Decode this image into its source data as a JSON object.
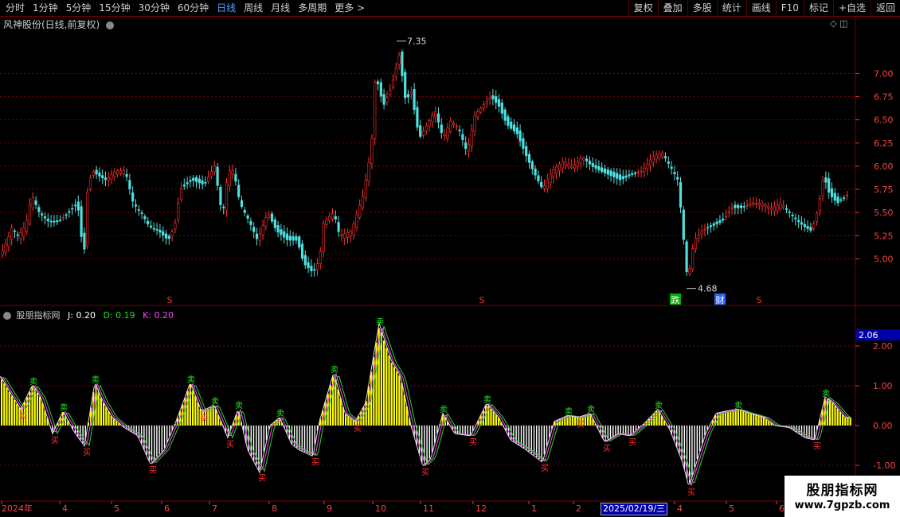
{
  "toolbar": {
    "periods": [
      "分时",
      "1分钟",
      "5分钟",
      "15分钟",
      "30分钟",
      "60分钟",
      "日线",
      "周线",
      "月线",
      "多周期",
      "更多 >"
    ],
    "active_period": "日线",
    "actions": [
      "复权",
      "叠加",
      "多股",
      "统计",
      "画线",
      "F10",
      "标记",
      "+自选",
      "返回"
    ]
  },
  "main_chart": {
    "title": "风神股份(日线,前复权)",
    "y_ticks": [
      "7.00",
      "6.75",
      "6.50",
      "6.25",
      "6.00",
      "5.75",
      "5.50",
      "5.25",
      "5.00"
    ],
    "max_label": "7.35",
    "min_label": "4.68",
    "markers": [
      "S",
      "S",
      "跌",
      "财",
      "S"
    ]
  },
  "indicator": {
    "name": "股朋指标网",
    "j_label": "J: 0.20",
    "d_label": "D: 0.19",
    "k_label": "K: 0.20",
    "y_ticks": [
      "2.00",
      "1.00",
      "0.00",
      "-1.00"
    ],
    "current_value": "2.06",
    "buy_glyph": "卖",
    "sell_glyph": "买"
  },
  "time_axis": {
    "labels": [
      "2024年",
      "4",
      "5",
      "6",
      "7",
      "8",
      "9",
      "10",
      "11",
      "12",
      "1",
      "2",
      "3",
      "4",
      "5",
      "6"
    ],
    "cursor_date": "2025/02/19/三"
  },
  "watermark": {
    "name": "股朋指标网",
    "url": "www.7gpzb.com"
  },
  "colors": {
    "up": "#ff3030",
    "down": "#4fe0e0",
    "grid": "#7a0000",
    "bar": "#ffff00",
    "neg_bar": "#ffffff"
  },
  "chart_data": [
    {
      "type": "candlestick",
      "title": "风神股份(日线,前复权)",
      "ylim": [
        4.6,
        7.45
      ],
      "y_ticks": [
        7.0,
        6.75,
        6.5,
        6.25,
        6.0,
        5.75,
        5.5,
        5.25,
        5.0
      ],
      "max": 7.35,
      "min": 4.68,
      "close_path": [
        [
          0,
          5.05
        ],
        [
          8,
          5.2
        ],
        [
          14,
          5.35
        ],
        [
          20,
          5.25
        ],
        [
          27,
          5.3
        ],
        [
          34,
          5.45
        ],
        [
          38,
          5.7
        ],
        [
          48,
          5.5
        ],
        [
          60,
          5.4
        ],
        [
          72,
          5.4
        ],
        [
          85,
          5.5
        ],
        [
          96,
          5.6
        ],
        [
          104,
          5.0
        ],
        [
          108,
          5.7
        ],
        [
          114,
          5.95
        ],
        [
          122,
          5.9
        ],
        [
          132,
          5.85
        ],
        [
          144,
          5.95
        ],
        [
          156,
          5.95
        ],
        [
          166,
          5.6
        ],
        [
          176,
          5.5
        ],
        [
          186,
          5.35
        ],
        [
          198,
          5.3
        ],
        [
          210,
          5.2
        ],
        [
          218,
          5.35
        ],
        [
          225,
          5.75
        ],
        [
          240,
          5.85
        ],
        [
          255,
          5.8
        ],
        [
          268,
          6.0
        ],
        [
          278,
          5.45
        ],
        [
          285,
          5.95
        ],
        [
          292,
          5.95
        ],
        [
          300,
          5.6
        ],
        [
          312,
          5.4
        ],
        [
          322,
          5.2
        ],
        [
          335,
          5.5
        ],
        [
          346,
          5.3
        ],
        [
          360,
          5.2
        ],
        [
          372,
          5.2
        ],
        [
          380,
          4.95
        ],
        [
          392,
          4.85
        ],
        [
          400,
          5.0
        ],
        [
          405,
          5.4
        ],
        [
          418,
          5.5
        ],
        [
          425,
          5.25
        ],
        [
          440,
          5.3
        ],
        [
          455,
          5.7
        ],
        [
          465,
          6.2
        ],
        [
          470,
          7.0
        ],
        [
          480,
          6.65
        ],
        [
          490,
          6.85
        ],
        [
          500,
          7.2
        ],
        [
          508,
          6.7
        ],
        [
          515,
          6.8
        ],
        [
          525,
          6.3
        ],
        [
          535,
          6.45
        ],
        [
          545,
          6.6
        ],
        [
          555,
          6.3
        ],
        [
          565,
          6.5
        ],
        [
          575,
          6.4
        ],
        [
          585,
          6.15
        ],
        [
          595,
          6.55
        ],
        [
          605,
          6.65
        ],
        [
          615,
          6.75
        ],
        [
          625,
          6.65
        ],
        [
          635,
          6.45
        ],
        [
          648,
          6.35
        ],
        [
          660,
          6.1
        ],
        [
          668,
          5.95
        ],
        [
          680,
          5.75
        ],
        [
          692,
          5.95
        ],
        [
          705,
          6.05
        ],
        [
          718,
          6.0
        ],
        [
          730,
          6.1
        ],
        [
          742,
          6.0
        ],
        [
          752,
          5.95
        ],
        [
          765,
          5.9
        ],
        [
          778,
          5.85
        ],
        [
          790,
          5.9
        ],
        [
          805,
          5.95
        ],
        [
          818,
          6.1
        ],
        [
          830,
          6.15
        ],
        [
          840,
          6.0
        ],
        [
          850,
          5.85
        ],
        [
          856,
          5.3
        ],
        [
          862,
          4.75
        ],
        [
          870,
          5.2
        ],
        [
          880,
          5.3
        ],
        [
          892,
          5.35
        ],
        [
          905,
          5.4
        ],
        [
          918,
          5.55
        ],
        [
          930,
          5.55
        ],
        [
          942,
          5.6
        ],
        [
          955,
          5.6
        ],
        [
          968,
          5.55
        ],
        [
          980,
          5.6
        ],
        [
          995,
          5.45
        ],
        [
          1008,
          5.35
        ],
        [
          1018,
          5.3
        ],
        [
          1026,
          5.55
        ],
        [
          1033,
          5.9
        ],
        [
          1040,
          5.7
        ],
        [
          1050,
          5.6
        ],
        [
          1058,
          5.65
        ],
        [
          1064,
          5.7
        ]
      ]
    },
    {
      "type": "bar",
      "title": "股朋指标网",
      "ylim": [
        -1.7,
        2.6
      ],
      "y_ticks": [
        2.0,
        1.0,
        0.0,
        -1.0
      ],
      "series": [
        {
          "name": "J",
          "last": 0.2
        },
        {
          "name": "D",
          "last": 0.19
        },
        {
          "name": "K",
          "last": 0.2
        }
      ],
      "wave": [
        [
          0,
          1.2
        ],
        [
          12,
          0.8
        ],
        [
          25,
          0.4
        ],
        [
          40,
          1.0
        ],
        [
          50,
          0.7
        ],
        [
          65,
          -0.2
        ],
        [
          78,
          0.35
        ],
        [
          92,
          -0.15
        ],
        [
          105,
          -0.5
        ],
        [
          118,
          1.05
        ],
        [
          128,
          0.6
        ],
        [
          140,
          0.2
        ],
        [
          155,
          -0.05
        ],
        [
          172,
          -0.25
        ],
        [
          188,
          -0.95
        ],
        [
          205,
          -0.6
        ],
        [
          220,
          0.1
        ],
        [
          238,
          1.05
        ],
        [
          252,
          0.35
        ],
        [
          268,
          0.5
        ],
        [
          285,
          -0.3
        ],
        [
          298,
          0.4
        ],
        [
          310,
          -0.6
        ],
        [
          325,
          -1.15
        ],
        [
          338,
          0.0
        ],
        [
          350,
          0.2
        ],
        [
          365,
          -0.45
        ],
        [
          375,
          -0.6
        ],
        [
          392,
          -0.75
        ],
        [
          400,
          0.1
        ],
        [
          418,
          1.3
        ],
        [
          432,
          0.3
        ],
        [
          445,
          0.1
        ],
        [
          458,
          0.55
        ],
        [
          475,
          2.5
        ],
        [
          490,
          1.6
        ],
        [
          502,
          1.2
        ],
        [
          515,
          0.0
        ],
        [
          530,
          -1.0
        ],
        [
          540,
          -0.8
        ],
        [
          555,
          0.3
        ],
        [
          570,
          -0.2
        ],
        [
          590,
          -0.25
        ],
        [
          610,
          0.55
        ],
        [
          625,
          0.2
        ],
        [
          640,
          -0.35
        ],
        [
          660,
          -0.6
        ],
        [
          680,
          -0.9
        ],
        [
          695,
          0.1
        ],
        [
          712,
          0.25
        ],
        [
          725,
          0.2
        ],
        [
          740,
          0.3
        ],
        [
          758,
          -0.4
        ],
        [
          775,
          -0.2
        ],
        [
          790,
          -0.25
        ],
        [
          808,
          0.05
        ],
        [
          825,
          0.4
        ],
        [
          840,
          -0.1
        ],
        [
          856,
          -0.9
        ],
        [
          864,
          -1.5
        ],
        [
          872,
          -1.0
        ],
        [
          885,
          -0.2
        ],
        [
          898,
          0.3
        ],
        [
          910,
          0.35
        ],
        [
          925,
          0.4
        ],
        [
          940,
          0.3
        ],
        [
          958,
          0.2
        ],
        [
          972,
          0.0
        ],
        [
          990,
          -0.05
        ],
        [
          1010,
          -0.3
        ],
        [
          1022,
          -0.35
        ],
        [
          1035,
          0.7
        ],
        [
          1045,
          0.55
        ],
        [
          1060,
          0.2
        ],
        [
          1068,
          0.2
        ]
      ]
    }
  ]
}
